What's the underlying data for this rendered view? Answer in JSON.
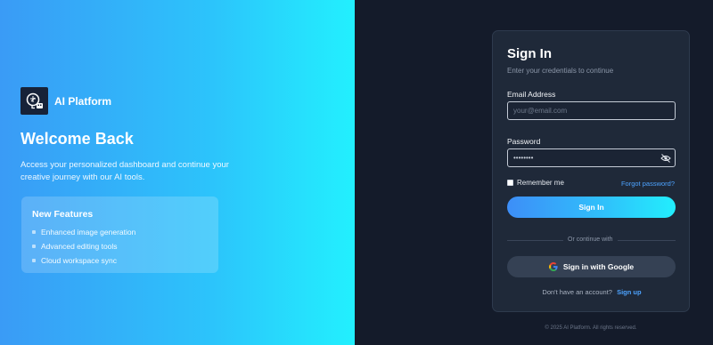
{
  "brand": {
    "name": "AI Platform",
    "logo_icon": "robot-brain-icon"
  },
  "hero": {
    "title": "Welcome Back",
    "description": "Access your personalized dashboard and continue your creative journey with our AI tools.",
    "features": {
      "title": "New Features",
      "items": [
        {
          "label": "Enhanced image generation"
        },
        {
          "label": "Advanced editing tools"
        },
        {
          "label": "Cloud workspace sync"
        }
      ]
    }
  },
  "signin": {
    "title": "Sign In",
    "subtitle": "Enter your credentials to continue",
    "email": {
      "label": "Email Address",
      "placeholder": "your@email.com",
      "value": ""
    },
    "password": {
      "label": "Password",
      "value": "password"
    },
    "remember_label": "Remember me",
    "forgot_label": "Forgot password?",
    "submit_label": "Sign In",
    "divider_text": "Or continue with",
    "google_label": "Sign in with Google",
    "signup_prompt": "Don't have an account?",
    "signup_link": "Sign up"
  },
  "footer": {
    "text": "© 2025 AI Platform. All rights reserved."
  },
  "colors": {
    "accent": "#4da3ff",
    "gradient_start": "#3a9bf6",
    "gradient_end": "#22f0fe",
    "card_bg": "#1f2939",
    "page_bg": "#141b2a"
  }
}
